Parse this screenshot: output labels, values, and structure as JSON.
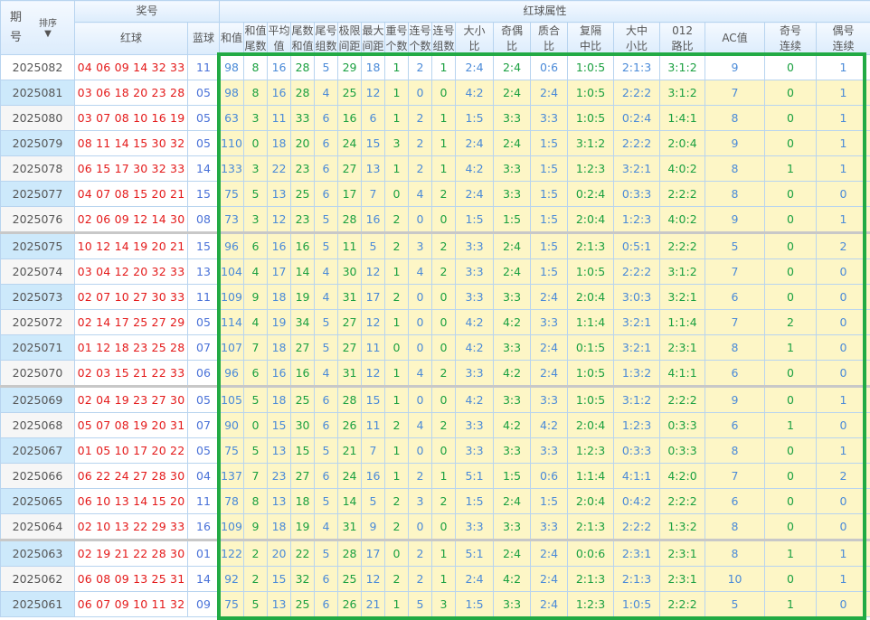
{
  "header": {
    "period": "期号",
    "sort_label": "排序",
    "sort_icon": "arrow-down-icon",
    "prize_group": "奖号",
    "red_ball": "红球",
    "blue_ball": "蓝球",
    "attr_group": "红球属性",
    "attr_columns": [
      [
        "和值",
        ""
      ],
      [
        "和值",
        "尾数"
      ],
      [
        "平均",
        "值"
      ],
      [
        "尾数",
        "和值"
      ],
      [
        "尾号",
        "组数"
      ],
      [
        "极限",
        "间距"
      ],
      [
        "最大",
        "间距"
      ],
      [
        "重号",
        "个数"
      ],
      [
        "连号",
        "个数"
      ],
      [
        "连号",
        "组数"
      ],
      [
        "大小",
        "比"
      ],
      [
        "奇偶",
        "比"
      ],
      [
        "质合",
        "比"
      ],
      [
        "复隔",
        "中比"
      ],
      [
        "大中",
        "小比"
      ],
      [
        "012",
        "路比"
      ],
      [
        "AC值",
        ""
      ],
      [
        "奇号",
        "连续"
      ],
      [
        "偶号",
        "连续"
      ]
    ]
  },
  "colors": {
    "highlight_border": "#22aa44",
    "red": "#e41a1a",
    "blue": "#4a8ad8",
    "green": "#1aa040"
  },
  "rows": [
    {
      "period": "2025082",
      "red": "04 06 09 14 32 33",
      "blue": "11",
      "attrs": [
        "98",
        "8",
        "16",
        "28",
        "5",
        "29",
        "18",
        "1",
        "2",
        "1",
        "2:4",
        "2:4",
        "0:6",
        "1:0:5",
        "2:1:3",
        "3:1:2",
        "9",
        "0",
        "1"
      ]
    },
    {
      "period": "2025081",
      "red": "03 06 18 20 23 28",
      "blue": "05",
      "attrs": [
        "98",
        "8",
        "16",
        "28",
        "4",
        "25",
        "12",
        "1",
        "0",
        "0",
        "4:2",
        "2:4",
        "2:4",
        "1:0:5",
        "2:2:2",
        "3:1:2",
        "7",
        "0",
        "1"
      ]
    },
    {
      "period": "2025080",
      "red": "03 07 08 10 16 19",
      "blue": "05",
      "attrs": [
        "63",
        "3",
        "11",
        "33",
        "6",
        "16",
        "6",
        "1",
        "2",
        "1",
        "1:5",
        "3:3",
        "3:3",
        "1:0:5",
        "0:2:4",
        "1:4:1",
        "8",
        "0",
        "1"
      ]
    },
    {
      "period": "2025079",
      "red": "08 11 14 15 30 32",
      "blue": "05",
      "attrs": [
        "110",
        "0",
        "18",
        "20",
        "6",
        "24",
        "15",
        "3",
        "2",
        "1",
        "2:4",
        "2:4",
        "1:5",
        "3:1:2",
        "2:2:2",
        "2:0:4",
        "9",
        "0",
        "1"
      ]
    },
    {
      "period": "2025078",
      "red": "06 15 17 30 32 33",
      "blue": "14",
      "attrs": [
        "133",
        "3",
        "22",
        "23",
        "6",
        "27",
        "13",
        "1",
        "2",
        "1",
        "4:2",
        "3:3",
        "1:5",
        "1:2:3",
        "3:2:1",
        "4:0:2",
        "8",
        "1",
        "1"
      ]
    },
    {
      "period": "2025077",
      "red": "04 07 08 15 20 21",
      "blue": "15",
      "attrs": [
        "75",
        "5",
        "13",
        "25",
        "6",
        "17",
        "7",
        "0",
        "4",
        "2",
        "2:4",
        "3:3",
        "1:5",
        "0:2:4",
        "0:3:3",
        "2:2:2",
        "8",
        "0",
        "0"
      ]
    },
    {
      "period": "2025076",
      "red": "02 06 09 12 14 30",
      "blue": "08",
      "attrs": [
        "73",
        "3",
        "12",
        "23",
        "5",
        "28",
        "16",
        "2",
        "0",
        "0",
        "1:5",
        "1:5",
        "1:5",
        "2:0:4",
        "1:2:3",
        "4:0:2",
        "9",
        "0",
        "1"
      ]
    },
    {
      "period": "2025075",
      "red": "10 12 14 19 20 21",
      "blue": "15",
      "attrs": [
        "96",
        "6",
        "16",
        "16",
        "5",
        "11",
        "5",
        "2",
        "3",
        "2",
        "3:3",
        "2:4",
        "1:5",
        "2:1:3",
        "0:5:1",
        "2:2:2",
        "5",
        "0",
        "2"
      ]
    },
    {
      "period": "2025074",
      "red": "03 04 12 20 32 33",
      "blue": "13",
      "attrs": [
        "104",
        "4",
        "17",
        "14",
        "4",
        "30",
        "12",
        "1",
        "4",
        "2",
        "3:3",
        "2:4",
        "1:5",
        "1:0:5",
        "2:2:2",
        "3:1:2",
        "7",
        "0",
        "0"
      ]
    },
    {
      "period": "2025073",
      "red": "02 07 10 27 30 33",
      "blue": "11",
      "attrs": [
        "109",
        "9",
        "18",
        "19",
        "4",
        "31",
        "17",
        "2",
        "0",
        "0",
        "3:3",
        "3:3",
        "2:4",
        "2:0:4",
        "3:0:3",
        "3:2:1",
        "6",
        "0",
        "0"
      ]
    },
    {
      "period": "2025072",
      "red": "02 14 17 25 27 29",
      "blue": "05",
      "attrs": [
        "114",
        "4",
        "19",
        "34",
        "5",
        "27",
        "12",
        "1",
        "0",
        "0",
        "4:2",
        "4:2",
        "3:3",
        "1:1:4",
        "3:2:1",
        "1:1:4",
        "7",
        "2",
        "0"
      ]
    },
    {
      "period": "2025071",
      "red": "01 12 18 23 25 28",
      "blue": "07",
      "attrs": [
        "107",
        "7",
        "18",
        "27",
        "5",
        "27",
        "11",
        "0",
        "0",
        "0",
        "4:2",
        "3:3",
        "2:4",
        "0:1:5",
        "3:2:1",
        "2:3:1",
        "8",
        "1",
        "0"
      ]
    },
    {
      "period": "2025070",
      "red": "02 03 15 21 22 33",
      "blue": "06",
      "attrs": [
        "96",
        "6",
        "16",
        "16",
        "4",
        "31",
        "12",
        "1",
        "4",
        "2",
        "3:3",
        "4:2",
        "2:4",
        "1:0:5",
        "1:3:2",
        "4:1:1",
        "6",
        "0",
        "0"
      ]
    },
    {
      "period": "2025069",
      "red": "02 04 19 23 27 30",
      "blue": "05",
      "attrs": [
        "105",
        "5",
        "18",
        "25",
        "6",
        "28",
        "15",
        "1",
        "0",
        "0",
        "4:2",
        "3:3",
        "3:3",
        "1:0:5",
        "3:1:2",
        "2:2:2",
        "9",
        "0",
        "1"
      ]
    },
    {
      "period": "2025068",
      "red": "05 07 08 19 20 31",
      "blue": "07",
      "attrs": [
        "90",
        "0",
        "15",
        "30",
        "6",
        "26",
        "11",
        "2",
        "4",
        "2",
        "3:3",
        "4:2",
        "4:2",
        "2:0:4",
        "1:2:3",
        "0:3:3",
        "6",
        "1",
        "0"
      ]
    },
    {
      "period": "2025067",
      "red": "01 05 10 17 20 22",
      "blue": "05",
      "attrs": [
        "75",
        "5",
        "13",
        "15",
        "5",
        "21",
        "7",
        "1",
        "0",
        "0",
        "3:3",
        "3:3",
        "3:3",
        "1:2:3",
        "0:3:3",
        "0:3:3",
        "8",
        "0",
        "1"
      ]
    },
    {
      "period": "2025066",
      "red": "06 22 24 27 28 30",
      "blue": "04",
      "attrs": [
        "137",
        "7",
        "23",
        "27",
        "6",
        "24",
        "16",
        "1",
        "2",
        "1",
        "5:1",
        "1:5",
        "0:6",
        "1:1:4",
        "4:1:1",
        "4:2:0",
        "7",
        "0",
        "2"
      ]
    },
    {
      "period": "2025065",
      "red": "06 10 13 14 15 20",
      "blue": "11",
      "attrs": [
        "78",
        "8",
        "13",
        "18",
        "5",
        "14",
        "5",
        "2",
        "3",
        "2",
        "1:5",
        "2:4",
        "1:5",
        "2:0:4",
        "0:4:2",
        "2:2:2",
        "6",
        "0",
        "0"
      ]
    },
    {
      "period": "2025064",
      "red": "02 10 13 22 29 33",
      "blue": "16",
      "attrs": [
        "109",
        "9",
        "18",
        "19",
        "4",
        "31",
        "9",
        "2",
        "0",
        "0",
        "3:3",
        "3:3",
        "3:3",
        "2:1:3",
        "2:2:2",
        "1:3:2",
        "8",
        "0",
        "0"
      ]
    },
    {
      "period": "2025063",
      "red": "02 19 21 22 28 30",
      "blue": "01",
      "attrs": [
        "122",
        "2",
        "20",
        "22",
        "5",
        "28",
        "17",
        "0",
        "2",
        "1",
        "5:1",
        "2:4",
        "2:4",
        "0:0:6",
        "2:3:1",
        "2:3:1",
        "8",
        "1",
        "1"
      ]
    },
    {
      "period": "2025062",
      "red": "06 08 09 13 25 31",
      "blue": "14",
      "attrs": [
        "92",
        "2",
        "15",
        "32",
        "6",
        "25",
        "12",
        "2",
        "2",
        "1",
        "2:4",
        "4:2",
        "2:4",
        "2:1:3",
        "2:1:3",
        "2:3:1",
        "10",
        "0",
        "1"
      ]
    },
    {
      "period": "2025061",
      "red": "06 07 09 10 11 32",
      "blue": "09",
      "attrs": [
        "75",
        "5",
        "13",
        "25",
        "6",
        "26",
        "21",
        "1",
        "5",
        "3",
        "1:5",
        "3:3",
        "2:4",
        "1:2:3",
        "1:0:5",
        "2:2:2",
        "5",
        "1",
        "0"
      ]
    }
  ]
}
